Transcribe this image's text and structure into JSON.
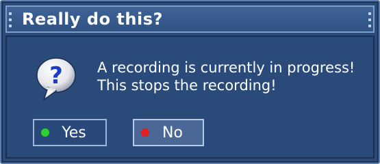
{
  "dialog": {
    "title": "Really do this?",
    "icon": "question-speech-bubble-icon",
    "message_line1": "A recording is currently in progress!",
    "message_line2": "This stops the recording!"
  },
  "buttons": {
    "yes_label": "Yes",
    "yes_indicator_color": "#2ed12e",
    "no_label": "No",
    "no_indicator_color": "#e02020",
    "selected": "No"
  },
  "colors": {
    "panel_background": "#2a4a7a",
    "titlebar_background": "#3a5d92",
    "text": "#ffffff"
  }
}
